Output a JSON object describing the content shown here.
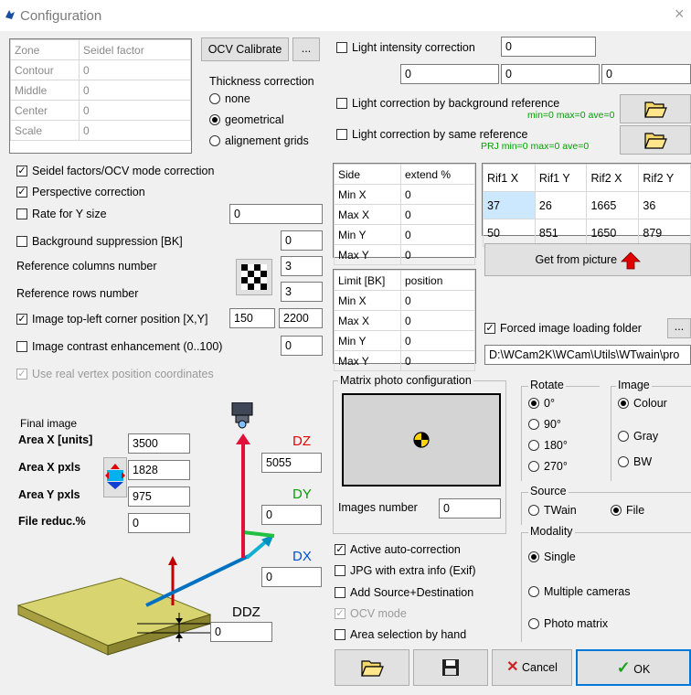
{
  "window": {
    "title": "Configuration",
    "close": "×"
  },
  "zone_table": {
    "headers": [
      "Zone",
      "Seidel factor"
    ],
    "rows": [
      [
        "Contour",
        "0"
      ],
      [
        "Middle",
        "0"
      ],
      [
        "Center",
        "0"
      ],
      [
        "Scale",
        "0"
      ]
    ]
  },
  "ocv_calibrate_label": "OCV Calibrate",
  "ellipsis": "...",
  "thickness": {
    "title": "Thickness correction",
    "options": [
      "none",
      "geometrical",
      "alignement grids"
    ],
    "selected": "geometrical"
  },
  "light": {
    "intensity_label": "Light intensity correction",
    "intensity_value": "0",
    "values": [
      "0",
      "0",
      "0"
    ],
    "background_label": "Light correction by background reference",
    "background_stats": "min=0 max=0 ave=0",
    "same_label": "Light correction by same reference",
    "same_stats": "PRJ min=0 max=0 ave=0"
  },
  "options": {
    "seidel": "Seidel factors/OCV mode correction",
    "perspective": "Perspective correction",
    "rate_y": "Rate for Y size",
    "rate_y_value": "0",
    "bk": "Background suppression [BK]",
    "bk_value": "0",
    "ref_cols": "Reference columns number",
    "ref_cols_value": "3",
    "ref_rows": "Reference rows number",
    "ref_rows_value": "3",
    "topleft": "Image top-left corner position [X,Y]",
    "topleft_x": "150",
    "topleft_y": "2200",
    "contrast": "Image contrast enhancement (0..100)",
    "contrast_value": "0",
    "real_vertex": "Use real vertex position coordinates"
  },
  "side_table": {
    "headers": [
      "Side",
      "extend %"
    ],
    "rows": [
      [
        "Min X",
        "0"
      ],
      [
        "Max X",
        "0"
      ],
      [
        "Min Y",
        "0"
      ],
      [
        "Max Y",
        "0"
      ]
    ]
  },
  "limit_table": {
    "headers": [
      "Limit [BK]",
      "position"
    ],
    "rows": [
      [
        "Min X",
        "0"
      ],
      [
        "Max X",
        "0"
      ],
      [
        "Min Y",
        "0"
      ],
      [
        "Max Y",
        "0"
      ]
    ]
  },
  "rif_table": {
    "headers": [
      "Rif1 X",
      "Rif1 Y",
      "Rif2 X",
      "Rif2 Y"
    ],
    "rows": [
      [
        "37",
        "26",
        "1665",
        "36"
      ],
      [
        "50",
        "851",
        "1650",
        "879"
      ]
    ]
  },
  "get_from_picture": "Get from picture",
  "forced_folder": {
    "label": "Forced image loading folder",
    "path": "D:\\WCam2K\\WCam\\Utils\\WTwain\\pro"
  },
  "final_image": {
    "title": "Final image",
    "area_x_units_label": "Area X [units]",
    "area_x_units": "3500",
    "area_x_pxls_label": "Area X pxls",
    "area_x_pxls": "1828",
    "area_y_pxls_label": "Area Y pxls",
    "area_y_pxls": "975",
    "file_reduc_label": "File reduc.%",
    "file_reduc": "0"
  },
  "diagram": {
    "dz": "DZ",
    "dz_value": "5055",
    "dy": "DY",
    "dy_value": "0",
    "dx": "DX",
    "dx_value": "0",
    "ddz": "DDZ",
    "ddz_value": "0",
    "colors": {
      "dz": "#e60000",
      "dy": "#00a000",
      "dx": "#0050d0"
    }
  },
  "matrix": {
    "title": "Matrix photo configuration",
    "images_number_label": "Images number",
    "images_number": "0"
  },
  "rotate": {
    "title": "Rotate",
    "options": [
      "0°",
      "90°",
      "180°",
      "270°"
    ],
    "selected": "0°"
  },
  "image_mode": {
    "title": "Image",
    "options": [
      "Colour",
      "Gray",
      "BW"
    ],
    "selected": "Colour"
  },
  "source": {
    "title": "Source",
    "options": [
      "TWain",
      "File"
    ],
    "selected": "File"
  },
  "modality": {
    "title": "Modality",
    "options": [
      "Single",
      "Multiple cameras",
      "Photo matrix"
    ],
    "selected": "Single"
  },
  "bottom_checks": {
    "auto": "Active auto-correction",
    "exif": "JPG with extra info (Exif)",
    "src_dst": "Add Source+Destination",
    "ocv": "OCV mode",
    "area": "Area selection by hand"
  },
  "buttons": {
    "cancel": "Cancel",
    "ok": "OK"
  }
}
